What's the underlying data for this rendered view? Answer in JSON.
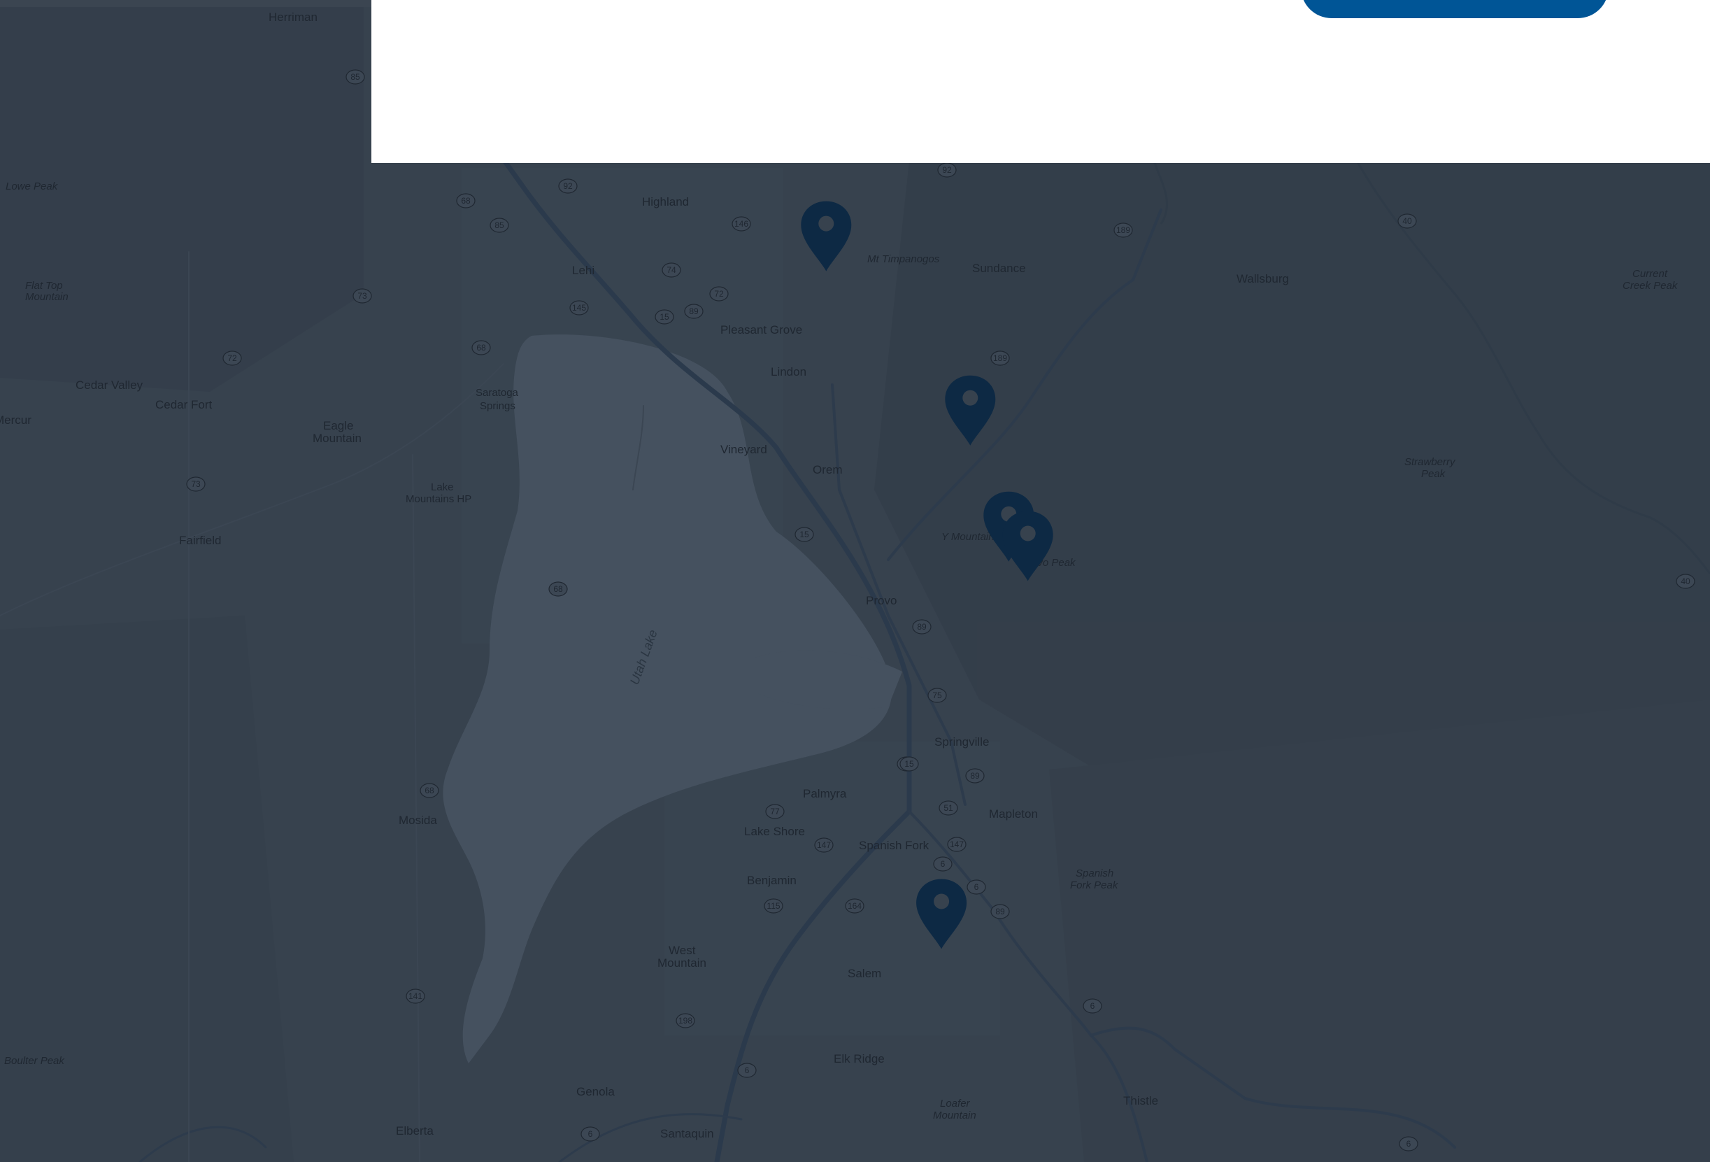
{
  "colors": {
    "overlay_map_bg": "#37424e",
    "lake": "#45515f",
    "road": "#2d3b4c",
    "marker": "#0d2944",
    "panel": "#ffffff",
    "button": "#005596"
  },
  "panel": {
    "button_label": ""
  },
  "map": {
    "lake_label": "Utah Lake",
    "places": {
      "herriman": "Herriman",
      "highland": "Highland",
      "lehi": "Lehi",
      "pleasant_grove": "Pleasant Grove",
      "lindon": "Lindon",
      "saratoga": "Saratoga",
      "saratoga2": "Springs",
      "vineyard": "Vineyard",
      "orem": "Orem",
      "provo": "Provo",
      "cedar_valley": "Cedar Valley",
      "cedar_fort": "Cedar Fort",
      "mercur": "Mercur",
      "eagle": "Eagle",
      "eagle2": "Mountain",
      "lake_mountains": "Lake",
      "lake_mountains2": "Mountains HP",
      "fairfield": "Fairfield",
      "sundance": "Sundance",
      "wallsburg": "Wallsburg",
      "springville": "Springville",
      "mapleton": "Mapleton",
      "palmyra": "Palmyra",
      "lake_shore": "Lake Shore",
      "spanish_fork": "Spanish Fork",
      "benjamin": "Benjamin",
      "west_mountain": "West",
      "west_mountain2": "Mountain",
      "salem": "Salem",
      "elk_ridge": "Elk Ridge",
      "mosida": "Mosida",
      "genola": "Genola",
      "elberta": "Elberta",
      "santaquin": "Santaquin",
      "thistle": "Thistle"
    },
    "peaks": {
      "lowe_peak": "Lowe Peak",
      "flat_top": "Flat Top",
      "flat_top2": "Mountain",
      "mt_timpanogos": "Mt Timpanogos",
      "current_creek": "Current",
      "current_creek2": "Creek Peak",
      "strawberry": "Strawberry",
      "strawberry2": "Peak",
      "y_mountain": "Y Mountain",
      "provo_peak": "Provo Peak",
      "spanish_fork_peak": "Spanish",
      "spanish_fork_peak2": "Fork Peak",
      "loafer": "Loafer",
      "loafer2": "Mountain",
      "boulter_peak": "Boulter Peak"
    },
    "shields": [
      "85",
      "92",
      "92",
      "68",
      "85",
      "72",
      "145",
      "74",
      "146",
      "89",
      "15",
      "73",
      "72",
      "68",
      "189",
      "40",
      "189",
      "189",
      "15",
      "68",
      "73",
      "89",
      "75",
      "89",
      "15",
      "51",
      "77",
      "147",
      "147",
      "6",
      "115",
      "164",
      "6",
      "89",
      "68",
      "141",
      "198",
      "6",
      "6",
      "40",
      "6",
      "6",
      "15"
    ],
    "markers": [
      {
        "name": "marker-lehi",
        "lat": 40.39,
        "lon": -111.85
      },
      {
        "name": "marker-orem",
        "lat": 40.3,
        "lon": -111.7
      },
      {
        "name": "marker-provo-1",
        "lat": 40.24,
        "lon": -111.66
      },
      {
        "name": "marker-provo-2",
        "lat": 40.23,
        "lon": -111.64
      },
      {
        "name": "marker-payson",
        "lat": 40.04,
        "lon": -111.73
      }
    ]
  }
}
